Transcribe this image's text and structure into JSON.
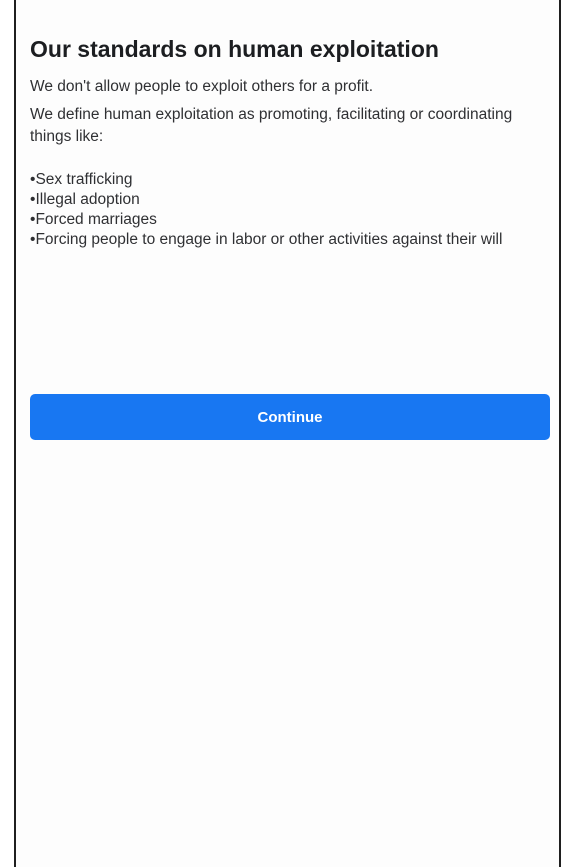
{
  "standards": {
    "title": "Our standards on human exploitation",
    "intro": "We don't allow people to exploit others for a profit.",
    "definition": "We define human exploitation as promoting, facilitating or coordinating things like:",
    "items": [
      "Sex trafficking",
      "Illegal adoption",
      "Forced marriages",
      "Forcing people to engage in labor or other activities against their will"
    ],
    "continue_label": "Continue"
  },
  "colors": {
    "button": "#1877f2",
    "text": "#1c1e21",
    "background": "#ffffff"
  }
}
